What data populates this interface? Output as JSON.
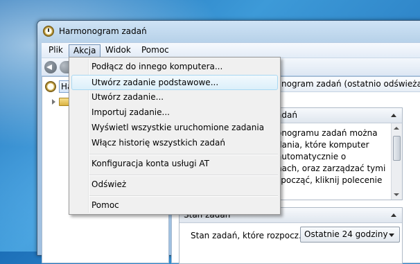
{
  "window": {
    "title": "Harmonogram zadań"
  },
  "menubar": {
    "items": [
      "Plik",
      "Akcja",
      "Widok",
      "Pomoc"
    ]
  },
  "tree": {
    "root_label": "Ha"
  },
  "right": {
    "header": "nogram zadań (ostatnio odświeżano:",
    "section1_title": "adań",
    "desc_lines": [
      "onogramu zadań można",
      "dania, które komputer",
      "automatycznie o",
      "nach, oraz zarządzać tymi",
      "zpocząć, kliknij polecenie"
    ],
    "section2_title": "Stan zadań",
    "status_label": "Stan zadań, które rozpocz...",
    "status_select": "Ostatnie 24 godziny"
  },
  "dropdown": {
    "items": [
      "Podłącz do innego komputera...",
      "Utwórz zadanie podstawowe...",
      "Utwórz zadanie...",
      "Importuj zadanie...",
      "Wyświetl wszystkie uruchomione zadania",
      "Włącz historię wszystkich zadań",
      "Konfiguracja konta usługi AT",
      "Odśwież",
      "Pomoc"
    ]
  },
  "colors": {
    "desktop": "#2a7fc4",
    "menu_hover": "#dbeffa",
    "window_frame": "#b9d3ea"
  }
}
